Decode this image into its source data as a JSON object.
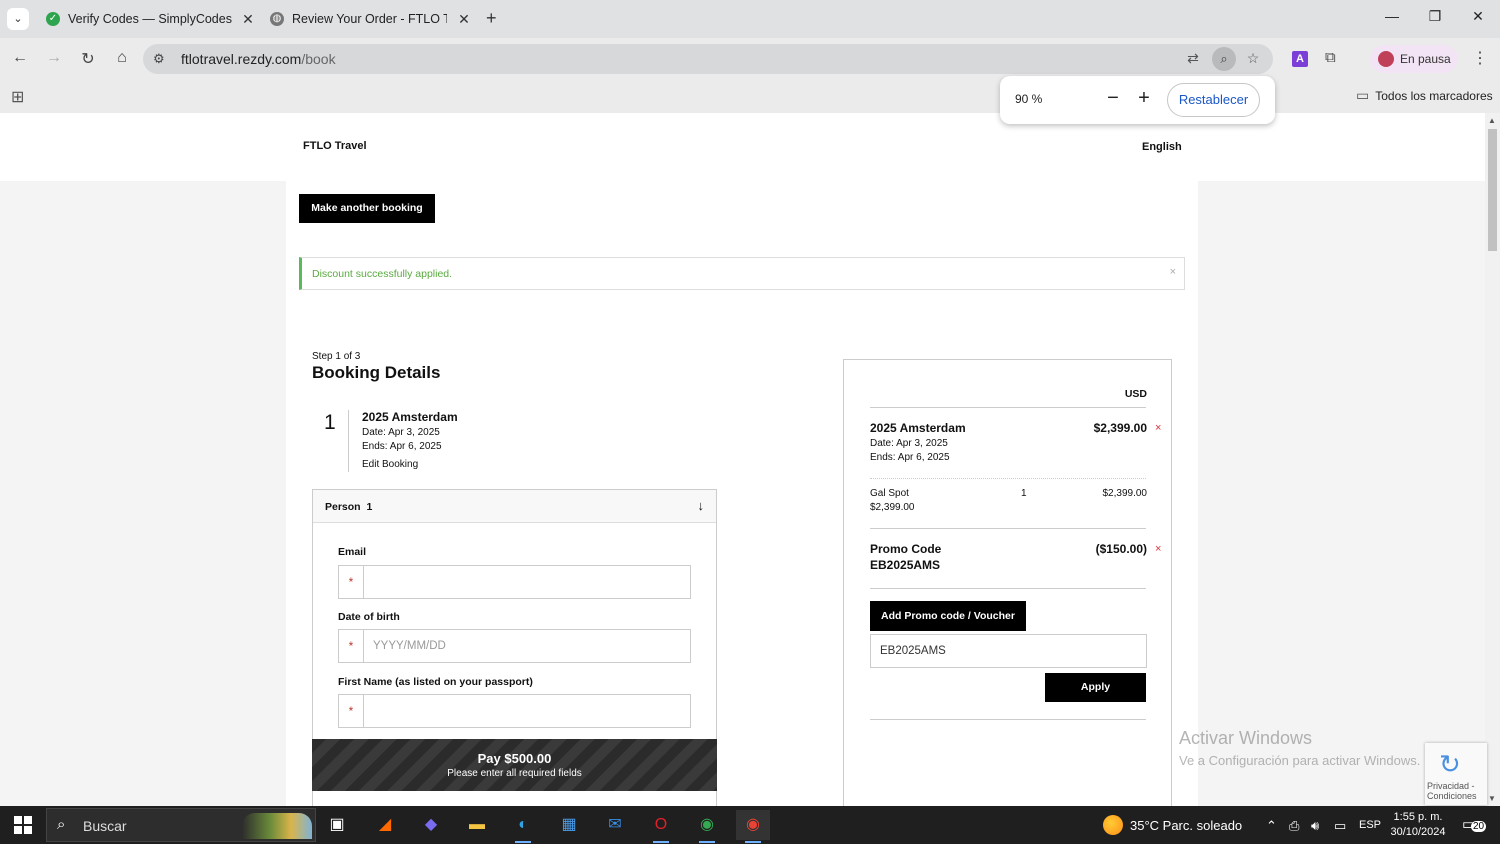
{
  "browser": {
    "tabs": [
      {
        "title": "Verify Codes — SimplyCodes",
        "active": true
      },
      {
        "title": "Review Your Order - FTLO Trave",
        "active": false
      }
    ],
    "url_host": "ftlotravel.rezdy.com",
    "url_path": "/book",
    "profile_label": "En pausa",
    "bookmarks_label": "Todos los marcadores",
    "zoom": {
      "value": "90 %",
      "reset_label": "Restablecer"
    }
  },
  "page": {
    "brand": "FTLO Travel",
    "language": "English",
    "make_booking_label": "Make another booking",
    "alert": "Discount successfully applied.",
    "alert_close": "×",
    "step": "Step 1 of 3",
    "title": "Booking Details",
    "item": {
      "number": "1",
      "name": "2025 Amsterdam",
      "date": "Date: Apr 3, 2025",
      "ends": "Ends: Apr 6, 2025",
      "edit": "Edit Booking"
    },
    "person": {
      "label": "Person",
      "number": "1",
      "fields": {
        "email_label": "Email",
        "email_value": "",
        "dob_label": "Date of birth",
        "dob_placeholder": "YYYY/MM/DD",
        "first_name_label": "First Name (as listed on your passport)",
        "first_name_value": ""
      },
      "required_mark": "*"
    },
    "summary": {
      "currency": "USD",
      "item_name": "2025 Amsterdam",
      "item_price": "$2,399.00",
      "item_date": "Date: Apr 3, 2025",
      "item_ends": "Ends: Apr 6, 2025",
      "line_name": "Gal Spot",
      "line_unit_price": "$2,399.00",
      "line_qty": "1",
      "line_total": "$2,399.00",
      "promo_label": "Promo Code",
      "promo_code": "EB2025AMS",
      "promo_discount": "($150.00)",
      "remove_mark": "×",
      "add_promo_label": "Add Promo code / Voucher",
      "promo_input_value": "EB2025AMS",
      "apply_label": "Apply"
    },
    "pay": {
      "amount": "Pay $500.00",
      "note": "Please enter all required fields"
    }
  },
  "overlay": {
    "watermark_title": "Activar Windows",
    "watermark_sub": "Ve a Configuración para activar Windows.",
    "recaptcha_text": "Privacidad - Condiciones"
  },
  "taskbar": {
    "search_placeholder": "Buscar",
    "weather": "35°C  Parc. soleado",
    "lang": "ESP",
    "time": "1:55 p. m.",
    "date": "30/10/2024",
    "notifications": "20"
  },
  "colors": {
    "accent": "#000000",
    "success": "#5cb85c",
    "remove": "#e0313d",
    "link_blue": "#1a57c9"
  }
}
